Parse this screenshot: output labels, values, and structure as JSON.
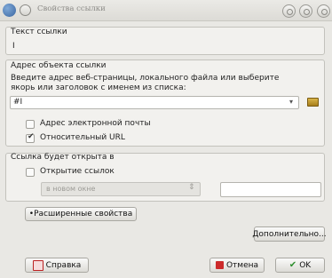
{
  "window": {
    "title": "Свойства ссылки"
  },
  "link_text": {
    "legend": "Текст ссылки",
    "value": "I"
  },
  "address": {
    "legend": "Адрес объекта ссылки",
    "hint_line1": "Введите адрес веб-страницы, локального файла или выберите",
    "hint_line2": "якорь или заголовок с именем из списка:",
    "value": "#I",
    "email_label": "Адрес электронной почты",
    "relative_label": "Относительный URL"
  },
  "open_in": {
    "legend": "Ссылка будет открыта в",
    "checkbox_label": "Открытие ссылок",
    "select_value": "в новом окне",
    "text_value": ""
  },
  "advanced_toggle": "•Расширенные свойства",
  "buttons": {
    "more": "Дополнительно...",
    "help": "Справка",
    "cancel": "Отмена",
    "ok": "OK"
  }
}
